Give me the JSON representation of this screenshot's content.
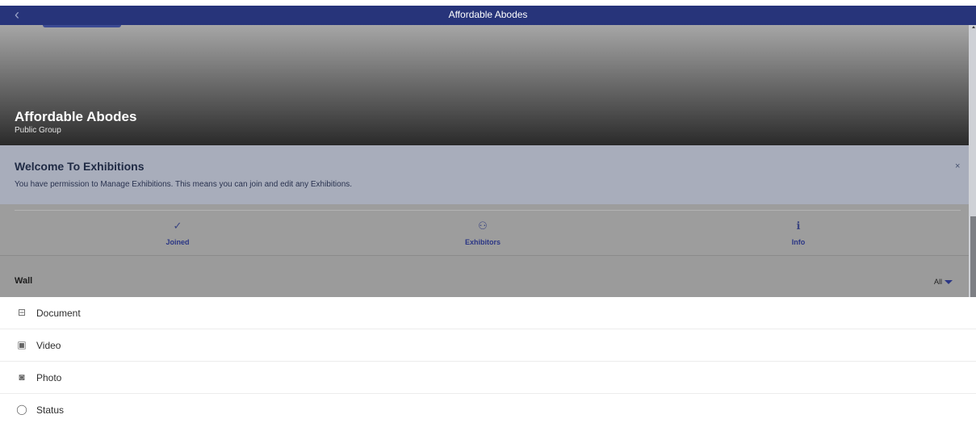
{
  "topbar": {
    "title": "Affordable Abodes",
    "back_glyph": "‹",
    "back_icon": "chevron-left-icon"
  },
  "group": {
    "name": "Affordable Abodes",
    "type": "Public Group"
  },
  "welcome": {
    "title": "Welcome To Exhibitions",
    "text": "You have permission to Manage Exhibitions. This means you can join and edit any Exhibitions.",
    "close_glyph": "×"
  },
  "tabs": [
    {
      "label": "Joined",
      "icon": "check-icon",
      "glyph": "✓"
    },
    {
      "label": "Exhibitors",
      "icon": "people-icon",
      "glyph": "⚇"
    },
    {
      "label": "Info",
      "icon": "info-icon",
      "glyph": "ℹ"
    }
  ],
  "wall": {
    "title": "Wall",
    "filter": "All"
  },
  "post_types": [
    {
      "label": "Document",
      "icon": "briefcase-icon",
      "glyph": "⊟"
    },
    {
      "label": "Video",
      "icon": "video-icon",
      "glyph": "▣"
    },
    {
      "label": "Photo",
      "icon": "camera-icon",
      "glyph": "◙"
    },
    {
      "label": "Status",
      "icon": "speech-bubble-icon",
      "glyph": "◯"
    }
  ],
  "colors": {
    "topbar": "#27347a",
    "accent": "#2b3685",
    "welcome_bg": "#a8adbb"
  }
}
